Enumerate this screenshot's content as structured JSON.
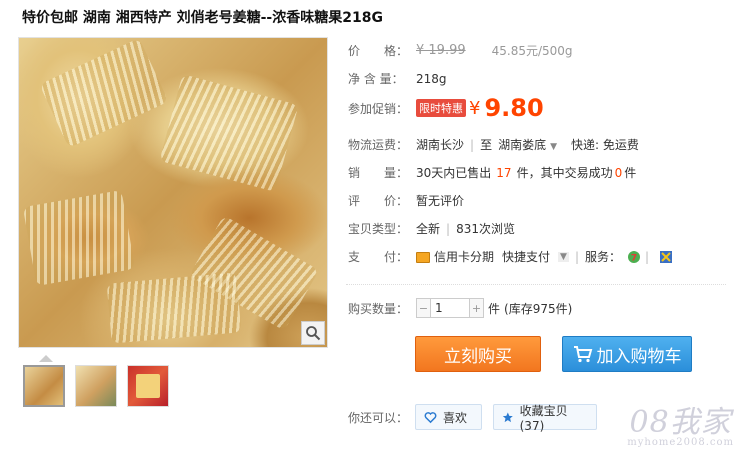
{
  "title": "特价包邮 湖南 湘西特产 刘俏老号姜糖--浓香味糖果218G",
  "price": {
    "label": "价　　格：",
    "original": "¥ 19.99",
    "unit_price": "45.85元/500g"
  },
  "net_weight": {
    "label": "净 含 量：",
    "value": "218g"
  },
  "promo": {
    "label": "参加促销：",
    "badge": "限时特惠",
    "currency": "¥",
    "price": "9.80"
  },
  "shipping": {
    "label": "物流运费：",
    "from": "湖南长沙",
    "to_prefix": "至",
    "to": "湖南娄底",
    "express": "快递: 免运费"
  },
  "sales": {
    "label": "销　　量：",
    "prefix": "30天内已售出",
    "sold": "17",
    "mid": "件，其中交易成功",
    "success": "0",
    "suffix": "件"
  },
  "review": {
    "label": "评　　价：",
    "value": "暂无评价"
  },
  "item_type": {
    "label": "宝贝类型：",
    "condition": "全新",
    "views": "831次浏览"
  },
  "payment": {
    "label": "支　　付：",
    "credit": "信用卡分期",
    "quick": "快捷支付",
    "service_label": "服务："
  },
  "quantity": {
    "label": "购买数量：",
    "value": "1",
    "unit": "件",
    "stock": "(库存975件)"
  },
  "buttons": {
    "buy": "立刻购买",
    "cart": "加入购物车"
  },
  "more": {
    "label": "你还可以：",
    "like": "喜欢",
    "fav": "收藏宝贝 (37)"
  },
  "watermark": {
    "brand": "08我家",
    "url": "myhome2008.com"
  },
  "colors": {
    "price_red": "#ff4400",
    "buy_orange": "#f2761f",
    "cart_blue": "#2b8fda"
  }
}
